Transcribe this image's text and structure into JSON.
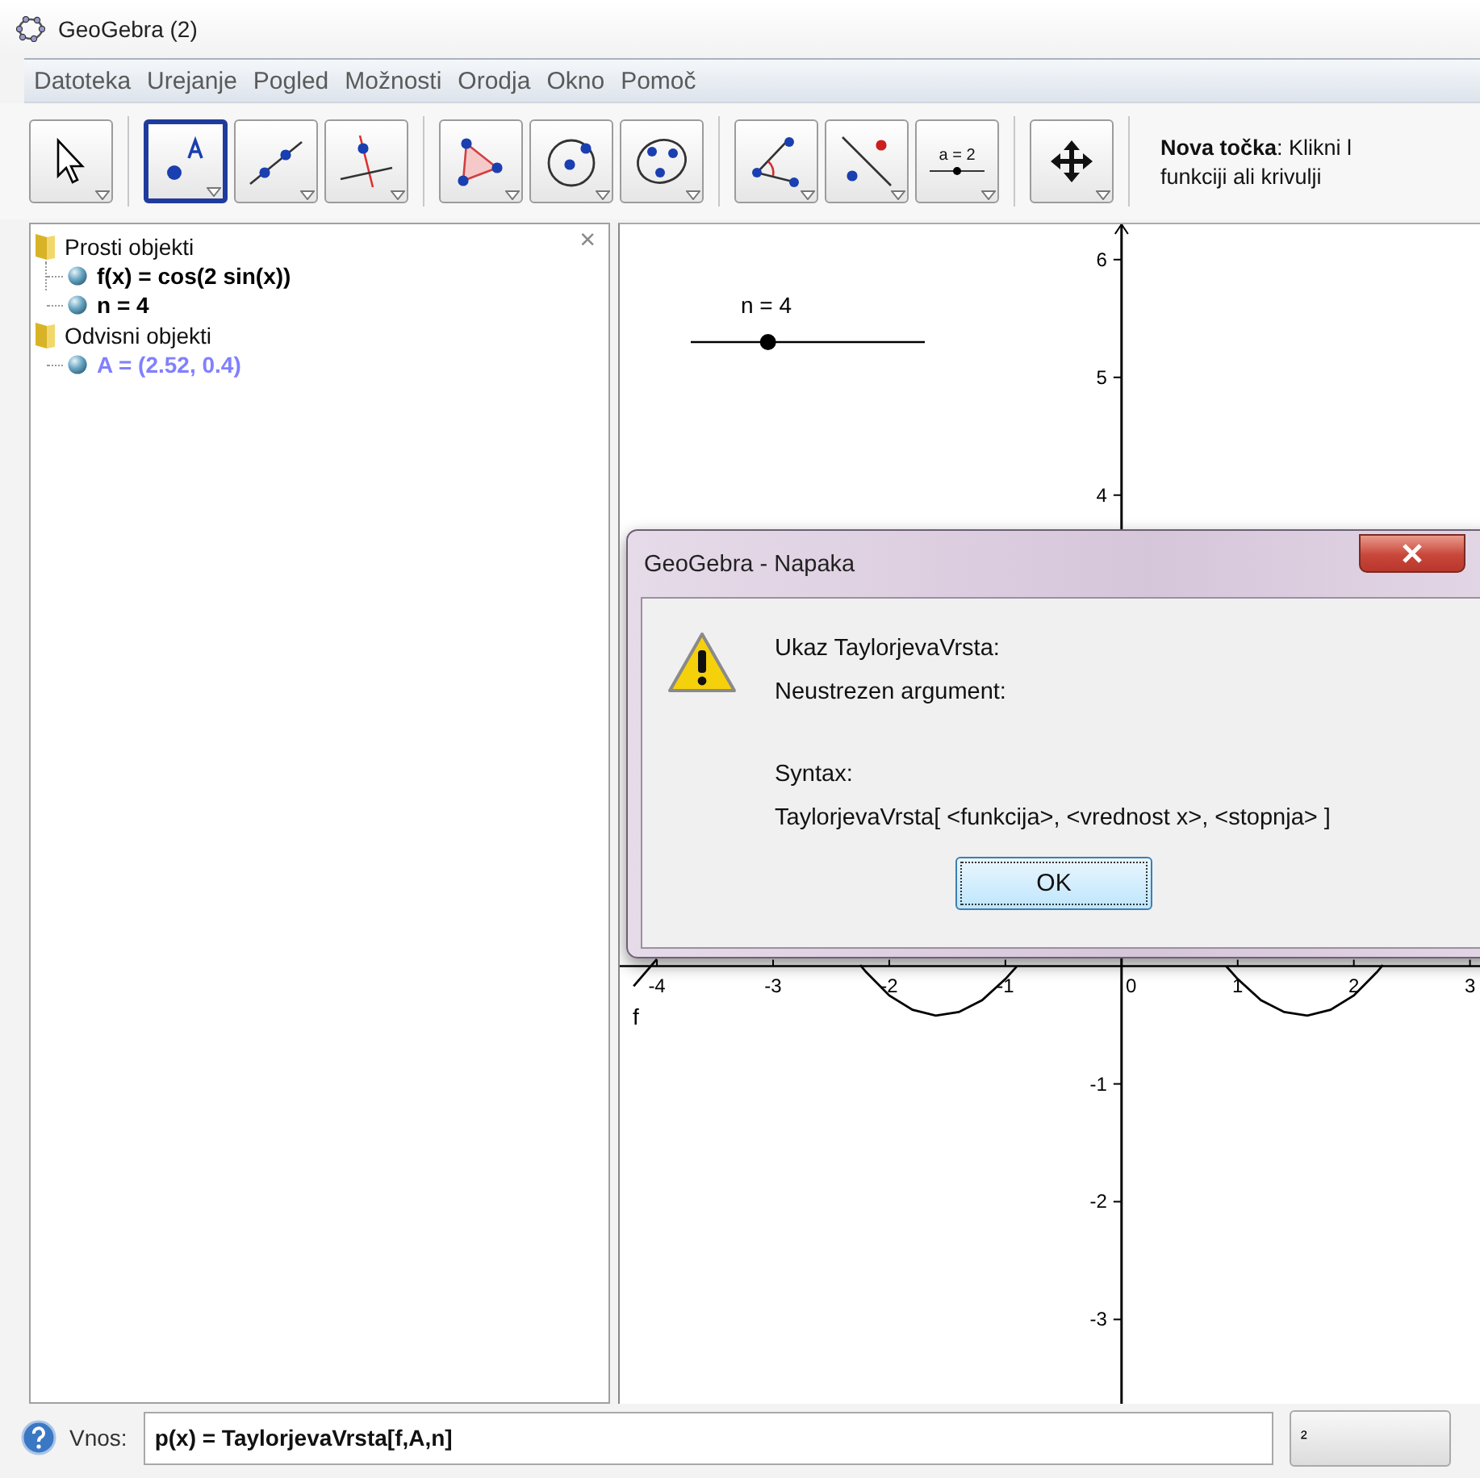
{
  "window": {
    "title": "GeoGebra (2)"
  },
  "menu": [
    "Datoteka",
    "Urejanje",
    "Pogled",
    "Možnosti",
    "Orodja",
    "Okno",
    "Pomoč"
  ],
  "toolbar": {
    "groups": [
      [
        {
          "kind": "move",
          "selected": false
        }
      ],
      [
        {
          "kind": "point",
          "selected": true
        },
        {
          "kind": "line",
          "selected": false
        },
        {
          "kind": "perpendicular",
          "selected": false
        }
      ],
      [
        {
          "kind": "polygon",
          "selected": false
        },
        {
          "kind": "circle",
          "selected": false
        },
        {
          "kind": "conic",
          "selected": false
        }
      ],
      [
        {
          "kind": "angle",
          "selected": false
        },
        {
          "kind": "reflect",
          "selected": false
        },
        {
          "kind": "slider",
          "selected": false
        }
      ],
      [
        {
          "kind": "move_view",
          "selected": false
        }
      ]
    ],
    "slider_tool_label": "a = 2",
    "tool_help": [
      "**Nova točka**: Klikni l",
      "funkciji ali krivulji"
    ]
  },
  "algebra": {
    "close": "×",
    "folders": [
      {
        "label": "Prosti objekti",
        "children": [
          {
            "label": "f(x) = cos(2 sin(x))",
            "color": "#000000"
          },
          {
            "label": "n = 4",
            "color": "#000000"
          }
        ]
      },
      {
        "label": "Odvisni objekti",
        "children": [
          {
            "label": "A = (2.52, 0.4)",
            "color": "#8080ff"
          }
        ]
      }
    ]
  },
  "graphics": {
    "slider": {
      "label": "n = 4",
      "level": 0.33
    },
    "chart_data": {
      "type": "line",
      "x": [
        -4.2,
        -4.0,
        -2.25,
        -2.2,
        -2.0,
        -1.8,
        -1.6,
        -1.4,
        -1.2,
        -1.0,
        -0.9,
        0.9,
        1.0,
        1.2,
        1.4,
        1.6,
        1.8,
        2.0,
        2.2,
        2.25
      ],
      "series": [
        {
          "name": "f",
          "color": "#000000",
          "values": [
            -0.17,
            0.06,
            0.01,
            -0.05,
            -0.25,
            -0.37,
            -0.42,
            -0.39,
            -0.29,
            -0.11,
            0.0,
            0.0,
            -0.11,
            -0.29,
            -0.39,
            -0.42,
            -0.37,
            -0.25,
            -0.05,
            0.01
          ]
        }
      ],
      "xlim": [
        -4.32,
        3.1
      ],
      "ylim": [
        -3.73,
        6.3
      ],
      "xticks": [
        -4,
        -3,
        -2,
        -1,
        0,
        1,
        2,
        3
      ],
      "yticks": [
        -3,
        -2,
        -1,
        4,
        5,
        6
      ]
    }
  },
  "dialog": {
    "title": "GeoGebra - Napaka",
    "message": [
      "Ukaz TaylorjevaVrsta:",
      "Neustrezen argument:"
    ],
    "syntax": [
      "Syntax:",
      "TaylorjevaVrsta[ <funkcija>, <vrednost x>, <stopnja> ]"
    ],
    "button": "OK"
  },
  "input": {
    "label": "Vnos:",
    "value": "p(x) = TaylorjevaVrsta[f,A,n]",
    "symbol": "²"
  }
}
